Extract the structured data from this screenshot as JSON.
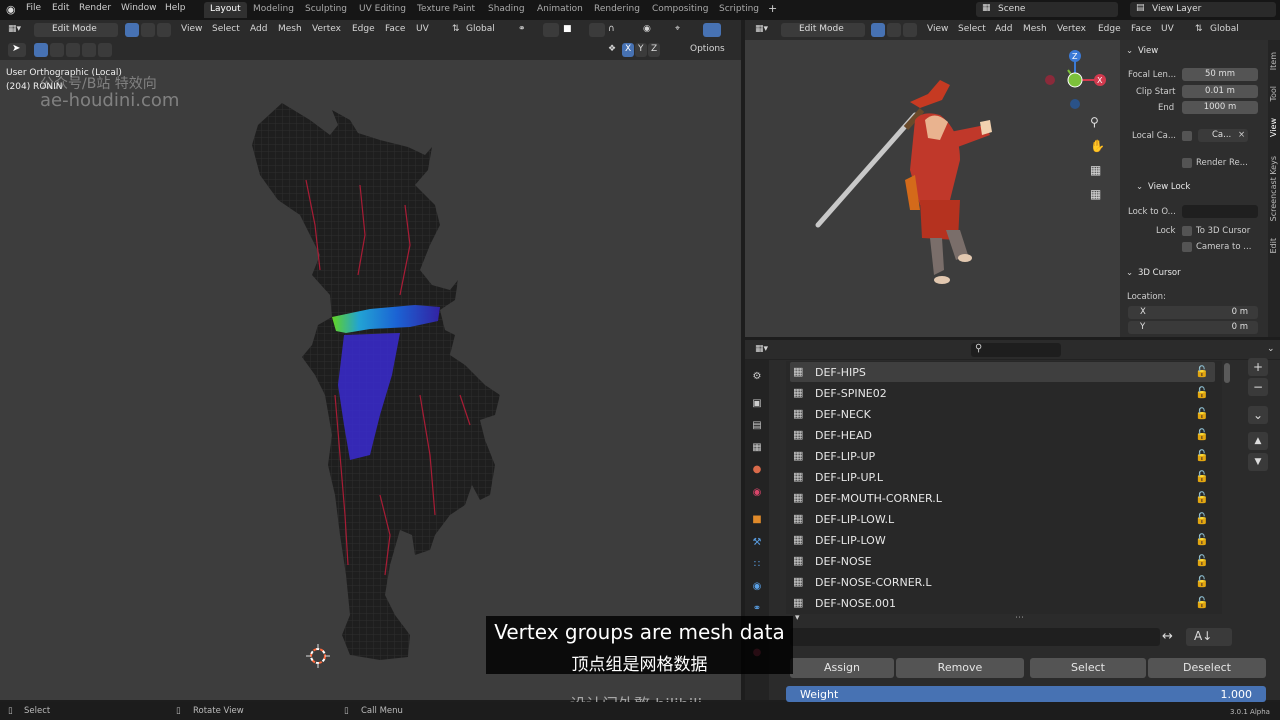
{
  "menu": [
    "File",
    "Edit",
    "Render",
    "Window",
    "Help"
  ],
  "workspaces": [
    "Layout",
    "Modeling",
    "Sculpting",
    "UV Editing",
    "Texture Paint",
    "Shading",
    "Animation",
    "Rendering",
    "Compositing",
    "Scripting"
  ],
  "active_workspace": "Layout",
  "add_tab": "+",
  "scene": "Scene",
  "view_layer": "View Layer",
  "viewport_header": {
    "mode": "Edit Mode",
    "menus": [
      "View",
      "Select",
      "Add",
      "Mesh",
      "Vertex",
      "Edge",
      "Face",
      "UV"
    ],
    "orientation": "Global"
  },
  "viewport_tools": {
    "axes": [
      "X",
      "Y",
      "Z"
    ],
    "options": "Options"
  },
  "viewport_overlay": {
    "view_name": "User Orthographic (Local)",
    "object_info": "(204) RONIN",
    "watermark_line1": "公众号/B站 特效向",
    "watermark_line2": "ae-houdini.com"
  },
  "npanel": {
    "view_section": "View",
    "focal_length_label": "Focal Len...",
    "focal_length": "50 mm",
    "clip_start_label": "Clip Start",
    "clip_start": "0.01 m",
    "end_label": "End",
    "clip_end": "1000 m",
    "local_camera_label": "Local Ca...",
    "local_camera_value": "Ca...",
    "render_region": "Render Re...",
    "view_lock_section": "View Lock",
    "lock_to_object_label": "Lock to O...",
    "lock_label": "Lock",
    "to_3d_cursor": "To 3D Cursor",
    "camera_to": "Camera to ...",
    "cursor_section": "3D Cursor",
    "location_label": "Location:",
    "x_label": "X",
    "x_value": "0 m",
    "y_label": "Y",
    "y_value": "0 m",
    "tabs": [
      "Item",
      "Tool",
      "View",
      "Screencast Keys",
      "Edit"
    ]
  },
  "vertex_groups": [
    "DEF-HIPS",
    "DEF-SPINE02",
    "DEF-NECK",
    "DEF-HEAD",
    "DEF-LIP-UP",
    "DEF-LIP-UP.L",
    "DEF-MOUTH-CORNER.L",
    "DEF-LIP-LOW.L",
    "DEF-LIP-LOW",
    "DEF-NOSE",
    "DEF-NOSE-CORNER.L",
    "DEF-NOSE.001"
  ],
  "active_vertex_group": "DEF-HIPS",
  "actions": {
    "assign": "Assign",
    "remove": "Remove",
    "select": "Select",
    "deselect": "Deselect"
  },
  "weight": {
    "label": "Weight",
    "value": "1.000"
  },
  "subtitle": {
    "english": "Vertex groups are mesh data",
    "chinese": "顶点组是网格数据",
    "credit": "设计门外憨 bilibili"
  },
  "status_bar": {
    "select": "Select",
    "rotate": "Rotate View",
    "call_menu": "Call Menu",
    "version": "3.0.1 Alpha"
  },
  "colors": {
    "accent": "#4772b3",
    "viewport_bg": "#3d3d3d",
    "panel_bg": "#2b2b2b"
  }
}
